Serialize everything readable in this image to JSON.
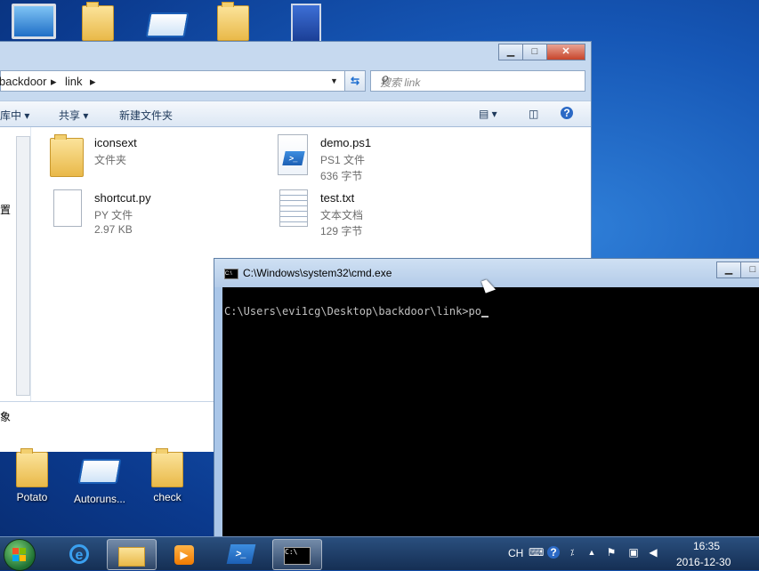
{
  "desktop": {
    "top_icons": [
      "computer-icon",
      "folder-icon",
      "app-icon",
      "folder-icon",
      "network-icon"
    ],
    "bottom_icons": [
      {
        "label": "Potato",
        "icon": "folder-icon"
      },
      {
        "label": "Autoruns...",
        "icon": "app-icon"
      },
      {
        "label": "check",
        "icon": "folder-icon"
      }
    ]
  },
  "explorer": {
    "breadcrumb": [
      "backdoor",
      "link"
    ],
    "search_placeholder": "搜索 link",
    "toolbar": {
      "include_library": "库中",
      "share": "共享",
      "new_folder": "新建文件夹"
    },
    "left_pane_label": "置",
    "status_label": "象",
    "files": [
      {
        "name": "iconsext",
        "type": "文件夹",
        "size": "",
        "icon": "folder-icon"
      },
      {
        "name": "demo.ps1",
        "type": "PS1 文件",
        "size": "636 字节",
        "icon": "powershell-file-icon"
      },
      {
        "name": "shortcut.py",
        "type": "PY 文件",
        "size": "2.97 KB",
        "icon": "document-icon"
      },
      {
        "name": "test.txt",
        "type": "文本文档",
        "size": "129 字节",
        "icon": "text-file-icon"
      }
    ]
  },
  "cmd": {
    "title": "C:\\Windows\\system32\\cmd.exe",
    "line": "C:\\Users\\evi1cg\\Desktop\\backdoor\\link>po"
  },
  "taskbar": {
    "language": "CH",
    "time": "16:35",
    "date": "2016-12-30"
  }
}
